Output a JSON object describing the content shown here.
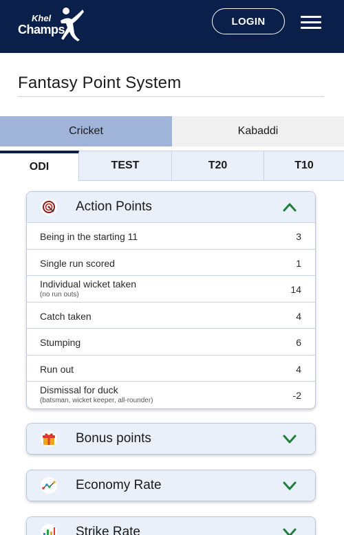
{
  "header": {
    "logo_top": "Khel",
    "logo_bottom": "Champs",
    "login_label": "LOGIN",
    "menu_icon": "hamburger-menu-icon"
  },
  "page": {
    "title": "Fantasy Point System"
  },
  "sport_tabs": [
    {
      "label": "Cricket",
      "active": true
    },
    {
      "label": "Kabaddi",
      "active": false
    }
  ],
  "format_tabs": [
    {
      "label": "ODI",
      "active": true
    },
    {
      "label": "TEST",
      "active": false
    },
    {
      "label": "T20",
      "active": false
    },
    {
      "label": "T10",
      "active": false
    }
  ],
  "sections": [
    {
      "title": "Action Points",
      "icon": "target-icon",
      "expanded": true,
      "rows": [
        {
          "label": "Being in the starting 11",
          "sub": "",
          "value": "3"
        },
        {
          "label": "Single run scored",
          "sub": "",
          "value": "1"
        },
        {
          "label": "Individual wicket taken",
          "sub": "(no run outs)",
          "value": "14"
        },
        {
          "label": "Catch taken",
          "sub": "",
          "value": "4"
        },
        {
          "label": "Stumping",
          "sub": "",
          "value": "6"
        },
        {
          "label": "Run out",
          "sub": "",
          "value": "4"
        },
        {
          "label": "Dismissal for duck",
          "sub": "(batsman, wicket keeper, all-rounder)",
          "value": "-2"
        }
      ]
    },
    {
      "title": "Bonus points",
      "icon": "gift-icon",
      "expanded": false
    },
    {
      "title": "Economy Rate",
      "icon": "trend-line-icon",
      "expanded": false
    },
    {
      "title": "Strike Rate",
      "icon": "bar-chart-icon",
      "expanded": false
    }
  ],
  "colors": {
    "header_bg": "#0a1f4a",
    "sport_tab_active": "#9fb4d8",
    "card_head_bg": "#eaf0fa",
    "chevron_green": "#1e7d3a"
  }
}
